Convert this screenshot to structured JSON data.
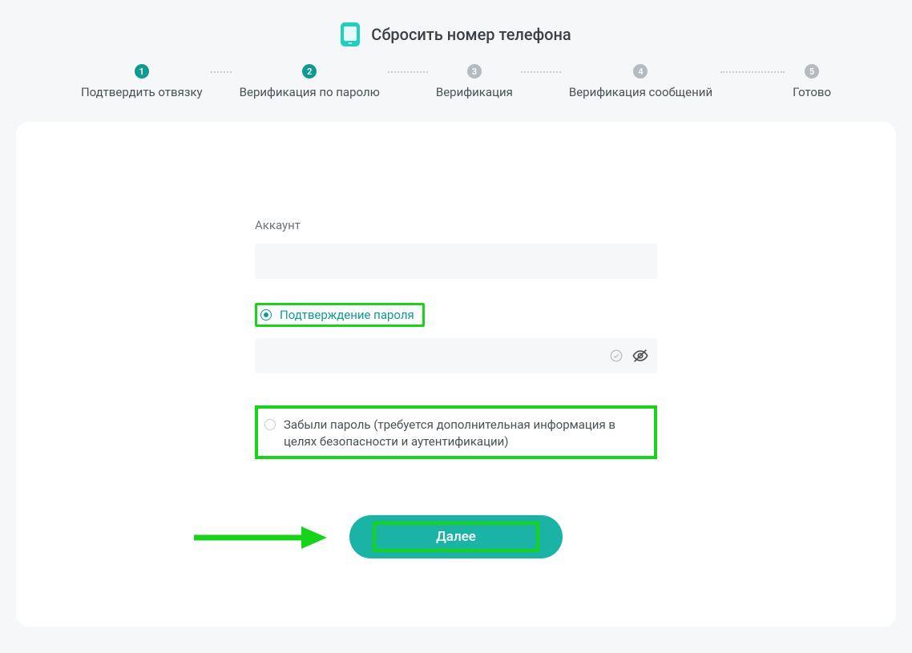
{
  "header": {
    "title": "Сбросить номер телефона"
  },
  "steps": [
    {
      "num": "1",
      "label": "Подтвердить отвязку",
      "active": true
    },
    {
      "num": "2",
      "label": "Верификация по паролю",
      "active": true
    },
    {
      "num": "3",
      "label": "Верификация",
      "active": false
    },
    {
      "num": "4",
      "label": "Верификация сообщений",
      "active": false
    },
    {
      "num": "5",
      "label": "Готово",
      "active": false
    }
  ],
  "form": {
    "account_label": "Аккаунт",
    "account_value": "",
    "option_confirm_password": "Подтверждение пароля",
    "password_value": "",
    "option_forgot": "Забыли пароль (требуется дополнительная информация в целях безопасности и аутентификации)",
    "next_label": "Далее"
  }
}
